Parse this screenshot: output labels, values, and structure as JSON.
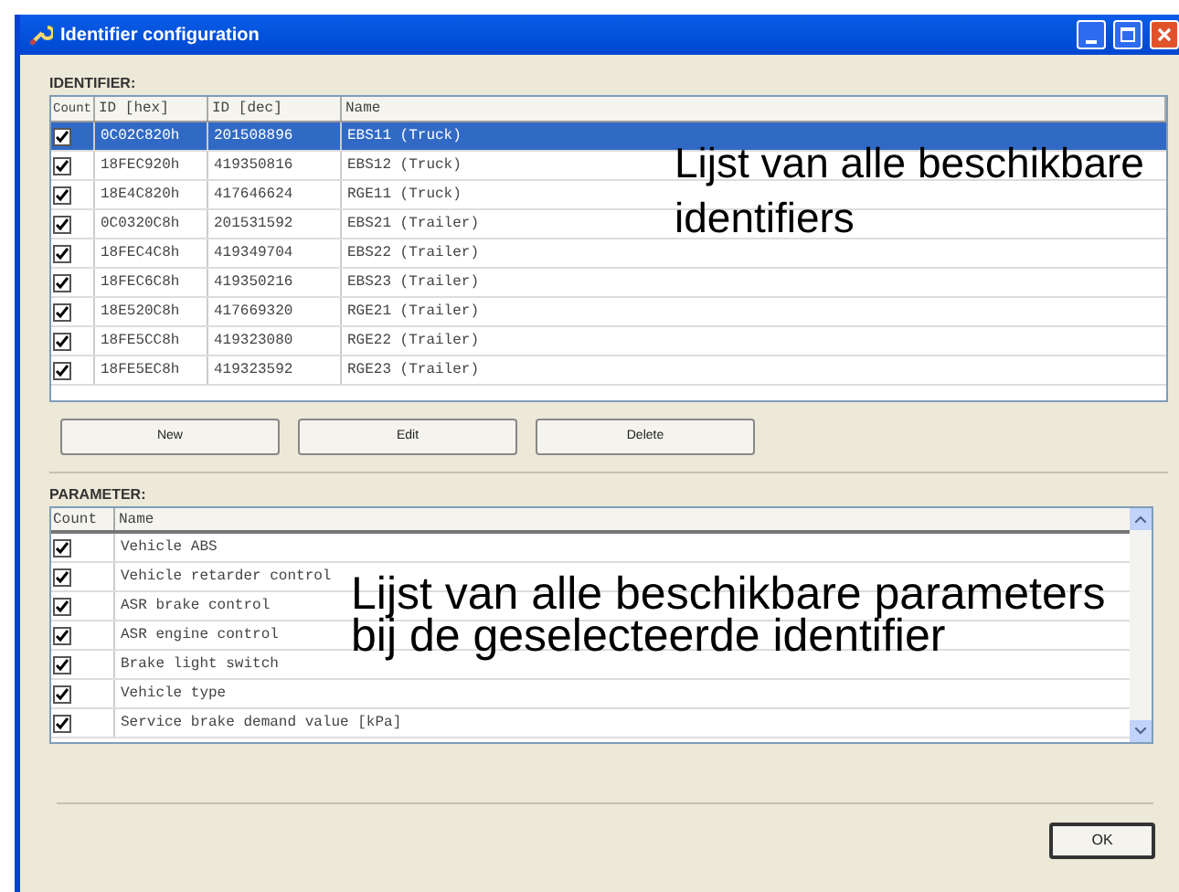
{
  "window": {
    "title": "Identifier configuration"
  },
  "identifier": {
    "label": "IDENTIFIER:",
    "columns": [
      "Count",
      "ID [hex]",
      "ID [dec]",
      "Name"
    ],
    "rows": [
      {
        "checked": true,
        "selected": true,
        "hex": "0C02C820h",
        "dec": "201508896",
        "name": "EBS11 (Truck)"
      },
      {
        "checked": true,
        "selected": false,
        "hex": "18FEC920h",
        "dec": "419350816",
        "name": "EBS12 (Truck)"
      },
      {
        "checked": true,
        "selected": false,
        "hex": "18E4C820h",
        "dec": "417646624",
        "name": "RGE11 (Truck)"
      },
      {
        "checked": true,
        "selected": false,
        "hex": "0C0320C8h",
        "dec": "201531592",
        "name": "EBS21 (Trailer)"
      },
      {
        "checked": true,
        "selected": false,
        "hex": "18FEC4C8h",
        "dec": "419349704",
        "name": "EBS22 (Trailer)"
      },
      {
        "checked": true,
        "selected": false,
        "hex": "18FEC6C8h",
        "dec": "419350216",
        "name": "EBS23 (Trailer)"
      },
      {
        "checked": true,
        "selected": false,
        "hex": "18E520C8h",
        "dec": "417669320",
        "name": "RGE21 (Trailer)"
      },
      {
        "checked": true,
        "selected": false,
        "hex": "18FE5CC8h",
        "dec": "419323080",
        "name": "RGE22 (Trailer)"
      },
      {
        "checked": true,
        "selected": false,
        "hex": "18FE5EC8h",
        "dec": "419323592",
        "name": "RGE23 (Trailer)"
      }
    ],
    "buttons": [
      "New",
      "Edit",
      "Delete"
    ]
  },
  "parameter": {
    "label": "PARAMETER:",
    "columns": [
      "Count",
      "Name"
    ],
    "rows": [
      {
        "checked": true,
        "name": "Vehicle ABS"
      },
      {
        "checked": true,
        "name": "Vehicle retarder control"
      },
      {
        "checked": true,
        "name": "ASR brake control"
      },
      {
        "checked": true,
        "name": "ASR engine control"
      },
      {
        "checked": true,
        "name": "Brake light switch"
      },
      {
        "checked": true,
        "name": "Vehicle type"
      },
      {
        "checked": true,
        "name": "Service brake demand value [kPa]"
      }
    ]
  },
  "ok_button": "OK",
  "annotations": [
    "Lijst van alle beschikbare identifiers",
    "Lijst van alle beschikbare parameters bij de geselecteerde identifier"
  ]
}
